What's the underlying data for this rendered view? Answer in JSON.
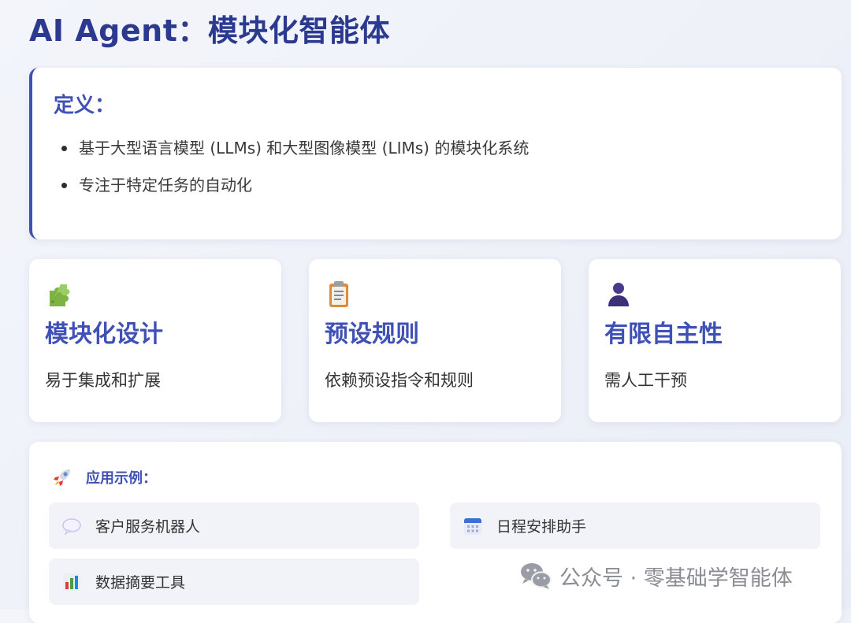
{
  "title": "AI Agent：模块化智能体",
  "definition": {
    "heading": "定义：",
    "items": [
      "基于大型语言模型 (LLMs) 和大型图像模型 (LIMs) 的模块化系统",
      "专注于特定任务的自动化"
    ]
  },
  "features": [
    {
      "icon": "puzzle-icon",
      "title": "模块化设计",
      "desc": "易于集成和扩展"
    },
    {
      "icon": "clipboard-icon",
      "title": "预设规则",
      "desc": "依赖预设指令和规则"
    },
    {
      "icon": "person-icon",
      "title": "有限自主性",
      "desc": "需人工干预"
    }
  ],
  "applications": {
    "icon": "rocket-icon",
    "heading": "应用示例：",
    "items": [
      {
        "icon": "speech-bubble-icon",
        "label": "客户服务机器人"
      },
      {
        "icon": "calendar-icon",
        "label": "日程安排助手"
      },
      {
        "icon": "bar-chart-icon",
        "label": "数据摘要工具"
      }
    ]
  },
  "watermark": {
    "icon": "wechat-icon",
    "text": "公众号 · 零基础学智能体"
  },
  "colors": {
    "title": "#2b3a8f",
    "accent": "#3f51b5",
    "card_background": "#ffffff",
    "item_background": "#f2f3f8"
  }
}
